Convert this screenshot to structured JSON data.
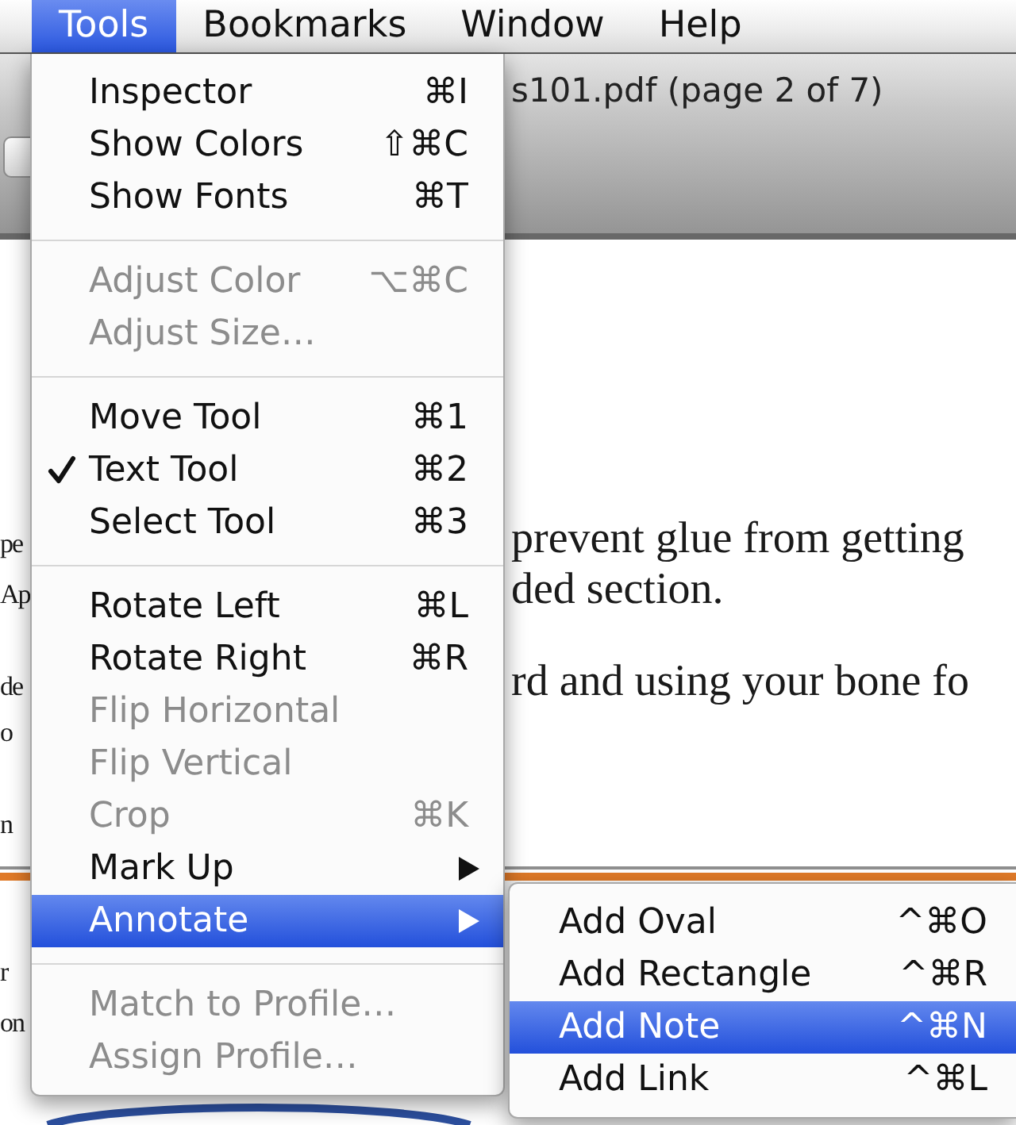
{
  "menu_bar": {
    "items": [
      {
        "label": "Tools",
        "selected": true
      },
      {
        "label": "Bookmarks",
        "selected": false
      },
      {
        "label": "Window",
        "selected": false
      },
      {
        "label": "Help",
        "selected": false
      }
    ]
  },
  "document_window": {
    "title": "s101.pdf (page 2 of 7)",
    "upper_text": [
      {
        "lines": [
          {
            "left": "pe",
            "right": "prevent glue from getting"
          },
          {
            "left": "Ap",
            "right": "ded section."
          }
        ]
      },
      {
        "lines": [
          {
            "left": "de",
            "right": "rd and using your bone fo"
          },
          {
            "left": "o"
          }
        ]
      },
      {
        "lines": [
          {
            "left": "n"
          }
        ]
      }
    ],
    "lower_text": [
      {
        "lines": [
          {
            "left": "r"
          },
          {
            "left": "on"
          }
        ]
      }
    ]
  },
  "tools_menu": {
    "sections": [
      {
        "items": [
          {
            "label": "Inspector",
            "shortcut": "⌘I",
            "kind": "command",
            "checked": false,
            "disabled": false,
            "selected": false
          },
          {
            "label": "Show Colors",
            "shortcut": "⇧⌘C",
            "kind": "command",
            "checked": false,
            "disabled": false,
            "selected": false
          },
          {
            "label": "Show Fonts",
            "shortcut": "⌘T",
            "kind": "command",
            "checked": false,
            "disabled": false,
            "selected": false
          }
        ]
      },
      {
        "items": [
          {
            "label": "Adjust Color",
            "shortcut": "⌥⌘C",
            "kind": "command",
            "checked": false,
            "disabled": true,
            "selected": false
          },
          {
            "label": "Adjust Size…",
            "kind": "command",
            "checked": false,
            "disabled": true,
            "selected": false
          }
        ]
      },
      {
        "items": [
          {
            "label": "Move Tool",
            "shortcut": "⌘1",
            "kind": "command",
            "checked": false,
            "disabled": false,
            "selected": false
          },
          {
            "label": "Text Tool",
            "shortcut": "⌘2",
            "kind": "command",
            "checked": true,
            "disabled": false,
            "selected": false
          },
          {
            "label": "Select Tool",
            "shortcut": "⌘3",
            "kind": "command",
            "checked": false,
            "disabled": false,
            "selected": false
          }
        ]
      },
      {
        "items": [
          {
            "label": "Rotate Left",
            "shortcut": "⌘L",
            "kind": "command",
            "checked": false,
            "disabled": false,
            "selected": false
          },
          {
            "label": "Rotate Right",
            "shortcut": "⌘R",
            "kind": "command",
            "checked": false,
            "disabled": false,
            "selected": false
          },
          {
            "label": "Flip Horizontal",
            "kind": "command",
            "checked": false,
            "disabled": true,
            "selected": false
          },
          {
            "label": "Flip Vertical",
            "kind": "command",
            "checked": false,
            "disabled": true,
            "selected": false
          },
          {
            "label": "Crop",
            "shortcut": "⌘K",
            "kind": "command",
            "checked": false,
            "disabled": true,
            "selected": false
          },
          {
            "label": "Mark Up",
            "kind": "submenu",
            "checked": false,
            "disabled": false,
            "selected": false
          },
          {
            "label": "Annotate",
            "kind": "submenu",
            "checked": false,
            "disabled": false,
            "selected": true,
            "submenu": {
              "items": [
                {
                  "label": "Add Oval",
                  "shortcut": "^⌘O",
                  "selected": false
                },
                {
                  "label": "Add Rectangle",
                  "shortcut": "^⌘R",
                  "selected": false
                },
                {
                  "label": "Add Note",
                  "shortcut": "^⌘N",
                  "selected": true
                },
                {
                  "label": "Add Link",
                  "shortcut": "^⌘L",
                  "selected": false
                }
              ]
            }
          }
        ]
      },
      {
        "items": [
          {
            "label": "Match to Profile…",
            "kind": "command",
            "checked": false,
            "disabled": true,
            "selected": false
          },
          {
            "label": "Assign Profile…",
            "kind": "command",
            "checked": false,
            "disabled": true,
            "selected": false
          }
        ]
      }
    ]
  }
}
